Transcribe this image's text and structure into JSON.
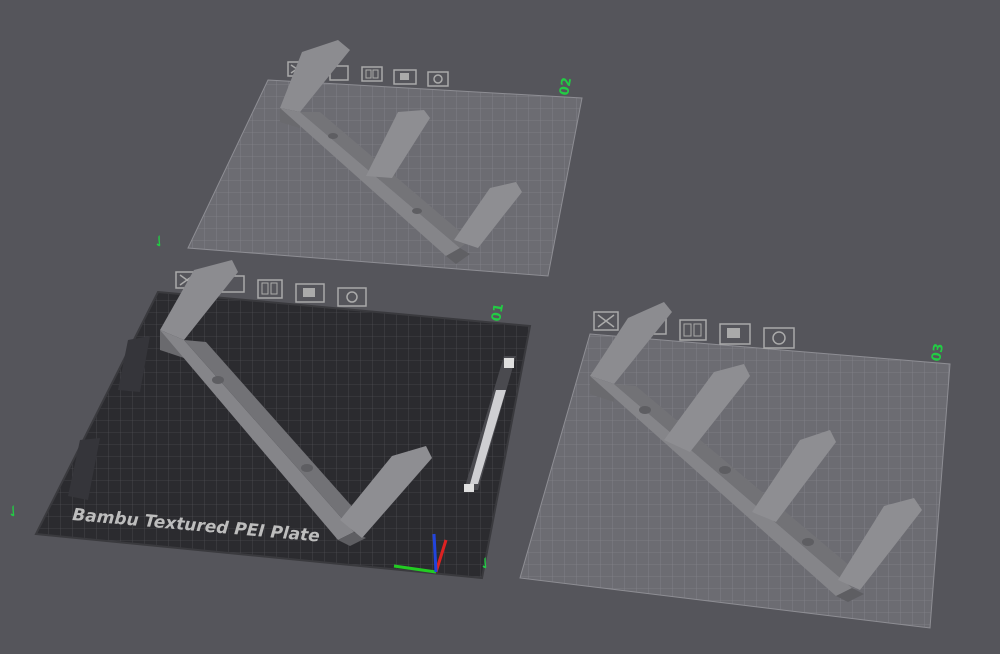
{
  "viewport": {
    "background": "#55555b",
    "accent_label_color": "#22cc44"
  },
  "plates": [
    {
      "id": "plate-01",
      "number": "01",
      "active": true,
      "bed_label": "Bambu Textured PEI Plate",
      "toolbar_icons": [
        "close-icon",
        "arrange-icon",
        "layout-icon",
        "lock-icon",
        "settings-icon"
      ]
    },
    {
      "id": "plate-02",
      "number": "02",
      "active": false,
      "toolbar_icons": [
        "close-icon",
        "arrange-icon",
        "layout-icon",
        "lock-icon",
        "settings-icon"
      ]
    },
    {
      "id": "plate-03",
      "number": "03",
      "active": false,
      "toolbar_icons": [
        "close-icon",
        "arrange-icon",
        "layout-icon",
        "lock-icon",
        "settings-icon"
      ]
    }
  ],
  "models": [
    {
      "plate": "plate-01",
      "name": "wall hook bracket",
      "pegs": 2
    },
    {
      "plate": "plate-02",
      "name": "wall hook bracket",
      "pegs": 3
    },
    {
      "plate": "plate-03",
      "name": "wall hook bracket",
      "pegs": 4
    }
  ],
  "axis_gizmo": {
    "x_color": "#22cc22",
    "y_color": "#dd2222",
    "z_color": "#2244dd"
  },
  "corner_markers": [
    "✓",
    "✓",
    "✓"
  ]
}
